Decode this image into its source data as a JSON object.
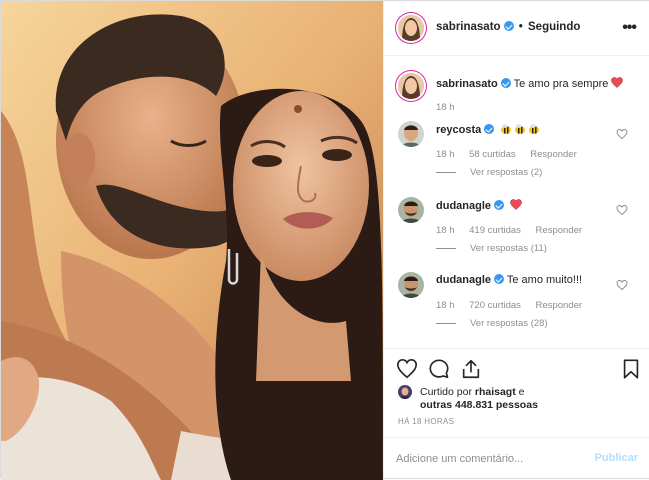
{
  "header": {
    "username": "sabrinasato",
    "separator": "•",
    "follow_status": "Seguindo",
    "more_icon": "more-horizontal-icon"
  },
  "caption": {
    "username": "sabrinasato",
    "text": "Te amo pra sempre",
    "emoji": "red-heart",
    "age": "18 h"
  },
  "comments": [
    {
      "username": "reycosta",
      "text_emoji": "bee bee bee",
      "age": "18 h",
      "likes": "58 curtidas",
      "reply": "Responder",
      "view_replies": "Ver respostas (2)"
    },
    {
      "username": "dudanagle",
      "text_emoji": "red-heart",
      "age": "18 h",
      "likes": "419 curtidas",
      "reply": "Responder",
      "view_replies": "Ver respostas (11)"
    },
    {
      "username": "dudanagle",
      "text": "Te amo muito!!!",
      "age": "18 h",
      "likes": "720 curtidas",
      "reply": "Responder",
      "view_replies": "Ver respostas (28)"
    }
  ],
  "likes": {
    "prefix": "Curtido por",
    "user": "rhaisagt",
    "connector": "e",
    "others": "outras 448.831 pessoas"
  },
  "timestamp": "HÁ 18 HORAS",
  "add_comment": {
    "placeholder": "Adicione um comentário...",
    "publish": "Publicar"
  },
  "colors": {
    "verified": "#3897f0",
    "heart": "#ed4956",
    "publish_disabled": "#b2dffc",
    "meta": "#8e8e8e"
  }
}
